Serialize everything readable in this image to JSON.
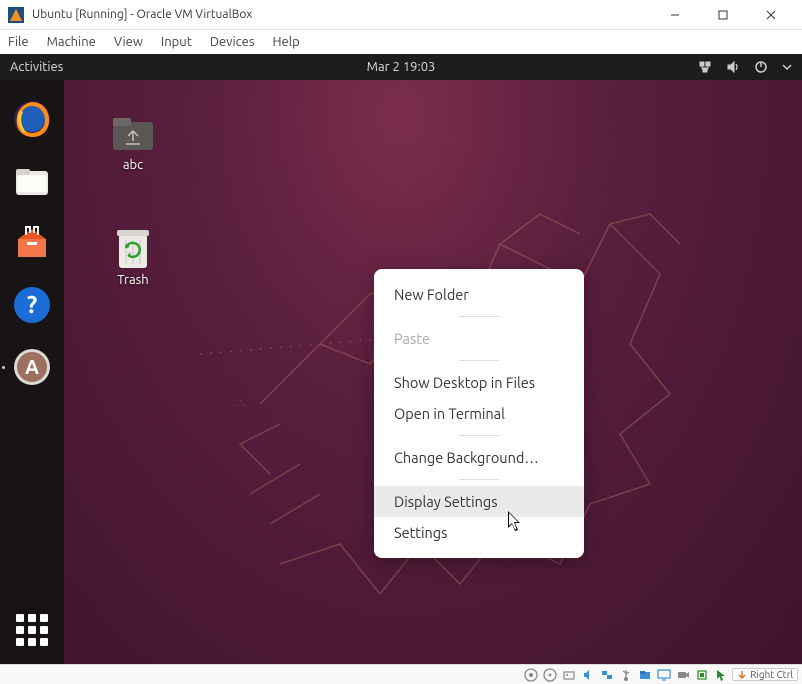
{
  "virtualbox": {
    "title": "Ubuntu [Running] - Oracle VM VirtualBox",
    "menu": {
      "file": "File",
      "machine": "Machine",
      "view": "View",
      "input": "Input",
      "devices": "Devices",
      "help": "Help"
    },
    "hostkey": "Right Ctrl"
  },
  "topbar": {
    "activities": "Activities",
    "datetime": "Mar 2  19:03"
  },
  "desktop_icons": {
    "folder": "abc",
    "trash": "Trash"
  },
  "context_menu": {
    "new_folder": "New Folder",
    "paste": "Paste",
    "show_files": "Show Desktop in Files",
    "open_terminal": "Open in Terminal",
    "change_bg": "Change Background…",
    "display_settings": "Display Settings",
    "settings": "Settings"
  }
}
